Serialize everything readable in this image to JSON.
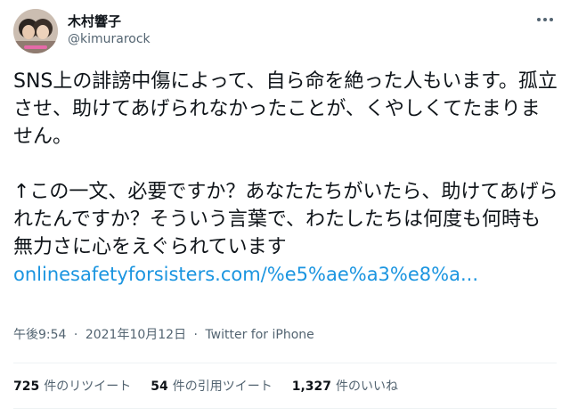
{
  "user": {
    "display_name": "木村響子",
    "handle": "@kimurarock"
  },
  "tweet": {
    "paragraph1": "SNS上の誹謗中傷によって、自ら命を絶った人もいます。孤立させ、助けてあげられなかったことが、くやしくてたまりません。",
    "paragraph2": "↑この一文、必要ですか？あなたたちがいたら、助けてあげられたんですか？そういう言葉で、わたしたちは何度も何時も無力さに心をえぐられています",
    "link": "onlinesafetyforsisters.com/%e5%ae%a3%e8%a..."
  },
  "meta": {
    "time": "午後9:54",
    "separator1": "·",
    "date": "2021年10月12日",
    "separator2": "·",
    "source": "Twitter for iPhone"
  },
  "stats": {
    "retweets": {
      "count": "725",
      "label": "件のリツイート"
    },
    "quotes": {
      "count": "54",
      "label": "件の引用ツイート"
    },
    "likes": {
      "count": "1,327",
      "label": "件のいいね"
    }
  },
  "icons": {
    "more": "more-horizontal-icon"
  }
}
